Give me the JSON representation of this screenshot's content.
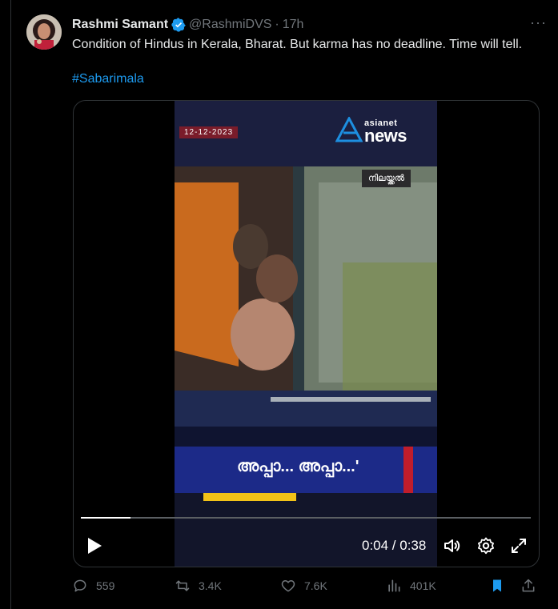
{
  "tweet": {
    "author_name": "Rashmi Samant",
    "handle": "@RashmiDVS",
    "separator": "·",
    "time": "17h",
    "more_label": "···",
    "text": "Condition of Hindus in Kerala, Bharat. But karma has no deadline. Time will tell.",
    "hashtag": "#Sabarimala"
  },
  "video": {
    "date_badge": "12-12-2023",
    "logo_top": "asianet",
    "logo_bottom": "news",
    "location_tag": "നിലയ്ക്കൽ",
    "lower_third_text": "അപ്പാ... അപ്പാ...'",
    "timecode": "0:04 / 0:38",
    "progress_fraction": 0.11
  },
  "actions": {
    "replies": "559",
    "reposts": "3.4K",
    "likes": "7.6K",
    "views": "401K"
  },
  "colors": {
    "accent": "#1d9bf0",
    "muted": "#71767b",
    "news_blue": "#1c2a88",
    "news_red": "#c01d2b"
  },
  "icons": {
    "verified": "verified-badge-icon",
    "play": "play-icon",
    "volume": "volume-icon",
    "settings": "gear-icon",
    "fullscreen": "fullscreen-icon",
    "reply": "reply-icon",
    "repost": "repost-icon",
    "like": "heart-icon",
    "views": "views-chart-icon",
    "bookmark": "bookmark-icon",
    "share": "share-icon"
  }
}
